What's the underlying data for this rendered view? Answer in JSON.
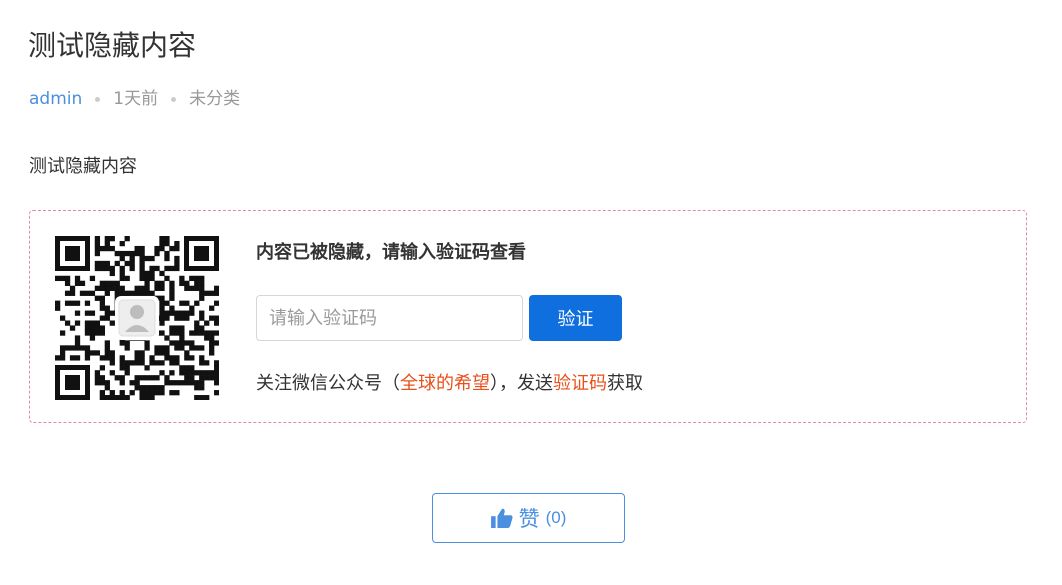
{
  "post": {
    "title": "测试隐藏内容",
    "author": "admin",
    "time": "1天前",
    "category": "未分类",
    "body": "测试隐藏内容"
  },
  "hidden": {
    "prompt": "内容已被隐藏，请输入验证码查看",
    "input_placeholder": "请输入验证码",
    "input_value": "",
    "verify_label": "验证",
    "follow_prefix": "关注微信公众号（",
    "account_name": "全球的希望",
    "follow_middle": "），发送",
    "keyword": "验证码",
    "follow_suffix": "获取",
    "qr_icon": "qr-code-icon",
    "colors": {
      "highlight": "#e8501c",
      "button": "#0f6fde",
      "border": "#e38aa9"
    }
  },
  "like": {
    "icon": "thumbs-up-icon",
    "label": "赞",
    "count": "(0)"
  }
}
